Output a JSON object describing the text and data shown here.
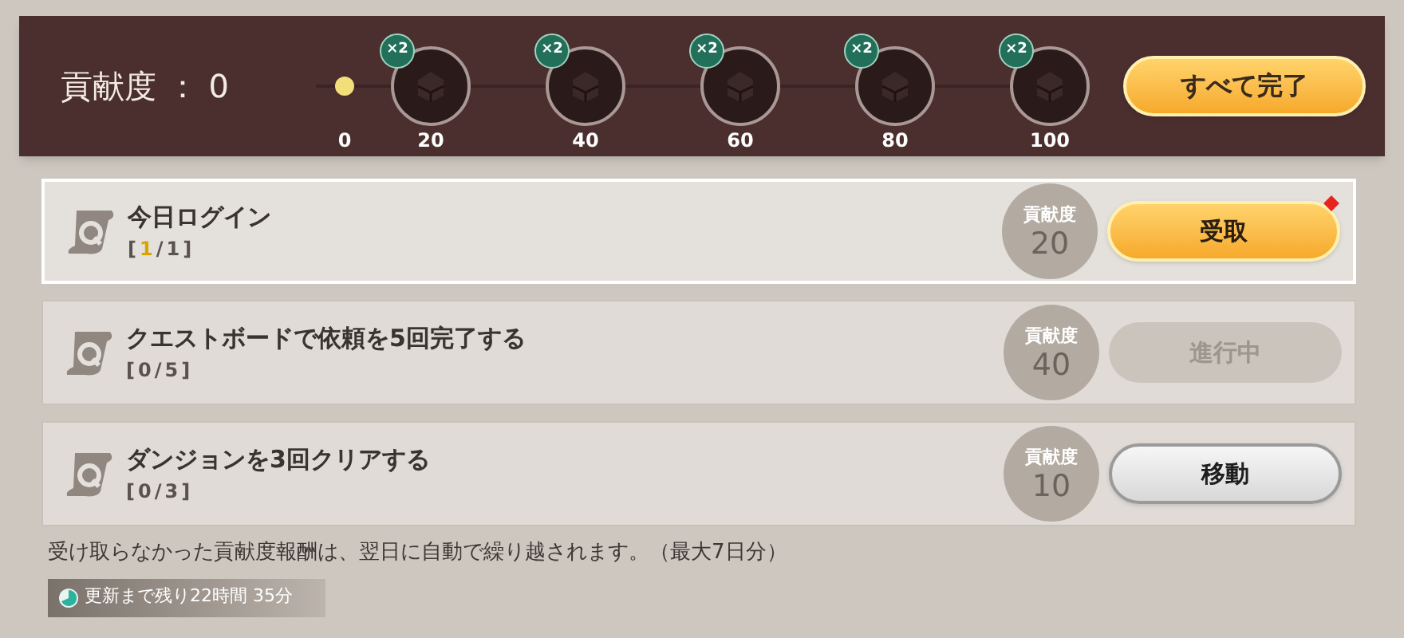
{
  "header": {
    "label": "貢献度",
    "separator": "：",
    "value": "0",
    "start_label": "0",
    "milestones": [
      {
        "multiplier": "×2",
        "label": "20"
      },
      {
        "multiplier": "×2",
        "label": "40"
      },
      {
        "multiplier": "×2",
        "label": "60"
      },
      {
        "multiplier": "×2",
        "label": "80"
      },
      {
        "multiplier": "×2",
        "label": "100"
      }
    ],
    "complete_all_button": "すべて完了"
  },
  "tasks": [
    {
      "title": "今日ログイン",
      "open": "[",
      "current": "1",
      "rest": "/1]",
      "done": true,
      "points_label": "貢献度",
      "points": "20",
      "button": {
        "kind": "claim",
        "label": "受取",
        "notification": true
      }
    },
    {
      "title": "クエストボードで依頼を5回完了する",
      "open": "[",
      "current": "0",
      "rest": "/5]",
      "done": false,
      "points_label": "貢献度",
      "points": "40",
      "button": {
        "kind": "progress",
        "label": "進行中",
        "notification": false
      }
    },
    {
      "title": "ダンジョンを3回クリアする",
      "open": "[",
      "current": "0",
      "rest": "/3]",
      "done": false,
      "points_label": "貢献度",
      "points": "10",
      "button": {
        "kind": "move",
        "label": "移動",
        "notification": false
      }
    }
  ],
  "note": "受け取らなかった貢献度報酬は、翌日に自動で繰り越されます。（最大7日分）",
  "timer": "更新まで残り22時間 35分"
}
